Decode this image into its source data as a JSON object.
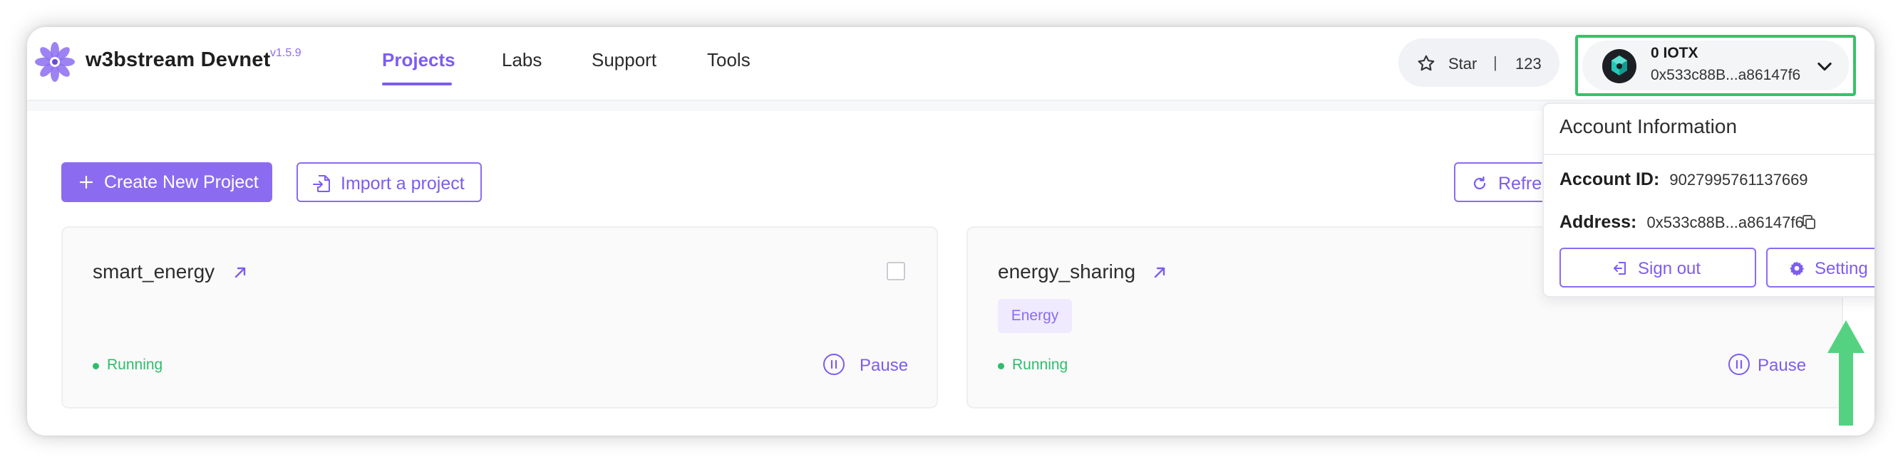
{
  "app": {
    "title": "w3bstream Devnet",
    "version": "v1.5.9",
    "accent_color": "#8b6cf0",
    "logo_icon": "flower-logo-icon"
  },
  "nav": {
    "items": [
      {
        "label": "Projects",
        "active": true
      },
      {
        "label": "Labs",
        "active": false
      },
      {
        "label": "Support",
        "active": false
      },
      {
        "label": "Tools",
        "active": false
      }
    ]
  },
  "github_star": {
    "icon": "star-icon",
    "label": "Star",
    "separator": "|",
    "count": "123"
  },
  "account": {
    "balance": "0 IOTX",
    "address_short": "0x533c88B...a86147f6",
    "highlight_color": "#37c268",
    "avatar_icon": "iotex-avatar-icon",
    "chevron_icon": "chevron-down-icon"
  },
  "account_dropdown": {
    "title": "Account Information",
    "account_id_label": "Account ID:",
    "account_id_value": "9027995761137669",
    "address_label": "Address:",
    "address_value": "0x533c88B...a86147f6",
    "copy_icon": "copy-icon",
    "sign_out_label": "Sign out",
    "settings_label": "Setting"
  },
  "actions": {
    "create_label": "Create New Project",
    "import_label": "Import a project",
    "refresh_label": "Refres"
  },
  "projects": [
    {
      "name": "smart_energy",
      "tag": "",
      "status": "Running",
      "action": "Pause"
    },
    {
      "name": "energy_sharing",
      "tag": "Energy",
      "status": "Running",
      "action": "Pause"
    }
  ],
  "annotation": {
    "arrow_color": "#4cd07a",
    "arrow_icon": "up-arrow-icon"
  }
}
